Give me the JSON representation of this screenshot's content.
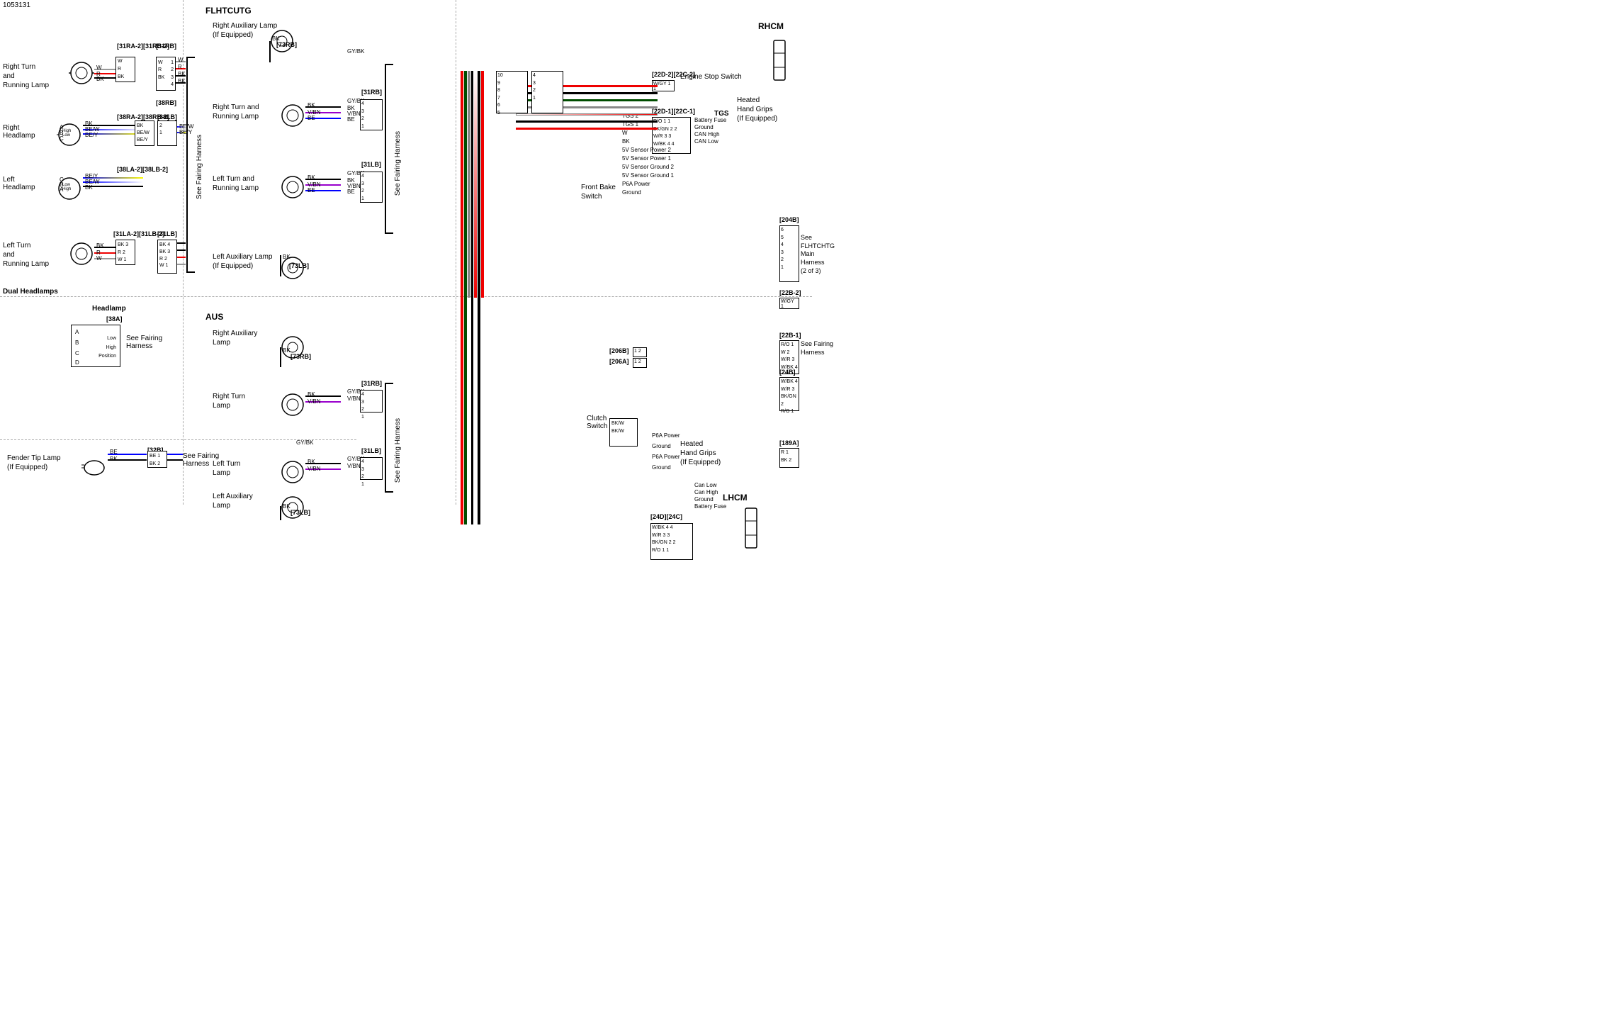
{
  "page": {
    "id": "1053131",
    "sections": {
      "left_col": {
        "title": "Dual Headlamps",
        "subsections": [
          {
            "label": "Right Turn and Running Lamp",
            "connectors": [
              "[31RA-2]",
              "[31RB-2]",
              "[31RB]",
              "[38RB]"
            ]
          },
          {
            "label": "Right Headlamp",
            "connectors": [
              "[38RA-2]",
              "[38RB-2]",
              "[38LB]"
            ]
          },
          {
            "label": "Left Headlamp",
            "connectors": [
              "[38LA-2]",
              "[38LB-2]"
            ]
          },
          {
            "label": "Left Turn and Running Lamp",
            "connectors": [
              "[31LA-2]",
              "[31LB-2]",
              "[31LB]"
            ]
          }
        ],
        "bottom_sections": [
          {
            "label": "Headlamp",
            "connector": "[38A]",
            "note": "See Fairing Harness"
          },
          {
            "label": "Fender Tip Lamp (If Equipped)",
            "connector": "[32B]",
            "note": "See Fairing Harness"
          }
        ]
      },
      "middle_col": {
        "top_label": "FLHTCUTG",
        "bottom_label": "AUS",
        "top_lamps": [
          "Right Auxiliary Lamp (If Equipped)",
          "Right Turn and Running Lamp",
          "Left Turn and Running Lamp",
          "Left Auxiliary Lamp (If Equipped)"
        ],
        "bottom_lamps": [
          "Right Auxiliary Lamp",
          "Right Turn Lamp",
          "Left Turn Lamp",
          "Left Auxiliary Lamp"
        ],
        "connectors": [
          "[73RB]",
          "[31RB]",
          "[73LB]",
          "[31LB]"
        ]
      },
      "right_col": {
        "label": "RHCM",
        "components": [
          {
            "name": "Engine Stop Switch",
            "connector": "[22D-2][22C-2]",
            "pins": [
              "W/GY 1 1"
            ]
          },
          {
            "name": "Battery Fuse",
            "pins": [
              "R/O 1 1"
            ]
          },
          {
            "name": "Ground",
            "pins": [
              "BK/GN 2 2"
            ]
          },
          {
            "name": "CAN High",
            "pins": [
              "W/R 3 3"
            ]
          },
          {
            "name": "CAN Low",
            "pins": [
              "W/BK 4 4"
            ]
          },
          {
            "name": "TGS",
            "connector": "[22D-1][22C-1]"
          },
          {
            "name": "Front Brake Switch"
          },
          {
            "name": "Clutch Switch"
          },
          {
            "name": "Heated Hand Grips (If Equipped)"
          },
          {
            "name": "See Fairing Harness"
          },
          {
            "name": "See FLHTCHTG Main Harness (2 of 3)",
            "connector": "[204B]"
          },
          {
            "name": "LHCM",
            "connector": "[24D][24C]"
          }
        ],
        "pin_labels": {
          "battery_fuse": "Battery Fuse",
          "ground": "Ground",
          "can_high": "CAN High",
          "can_low": "CAN Low"
        }
      }
    }
  }
}
